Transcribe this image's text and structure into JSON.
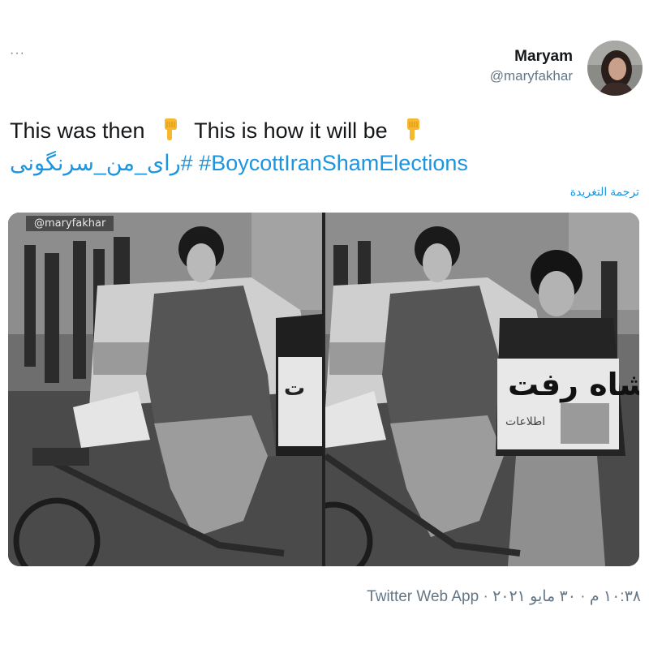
{
  "tweet": {
    "more_label": "···",
    "author_name": "Maryam",
    "author_handle": "@maryfakhar",
    "text_part1": "This was then",
    "text_part2": "This is how it will be",
    "hashtag_persian": "#رای_من_سرنگونی",
    "hashtag_english": "#BoycottIranShamElections",
    "translate_label": "ترجمة التغريدة",
    "watermark": "@maryfakhar",
    "newspaper_headline": "شاه رفت",
    "newspaper_masthead": "اطلاعات",
    "timestamp": "١٠:٣٨ م · ٣٠ مايو ٢٠٢١",
    "source_label": "Twitter Web App",
    "separator": " · "
  },
  "icons": {
    "pointing_down": "backhand-index-pointing-down-icon",
    "more": "more-dots-icon"
  },
  "colors": {
    "link": "#1b95e0",
    "secondary_text": "#657786",
    "primary_text": "#14171a"
  }
}
